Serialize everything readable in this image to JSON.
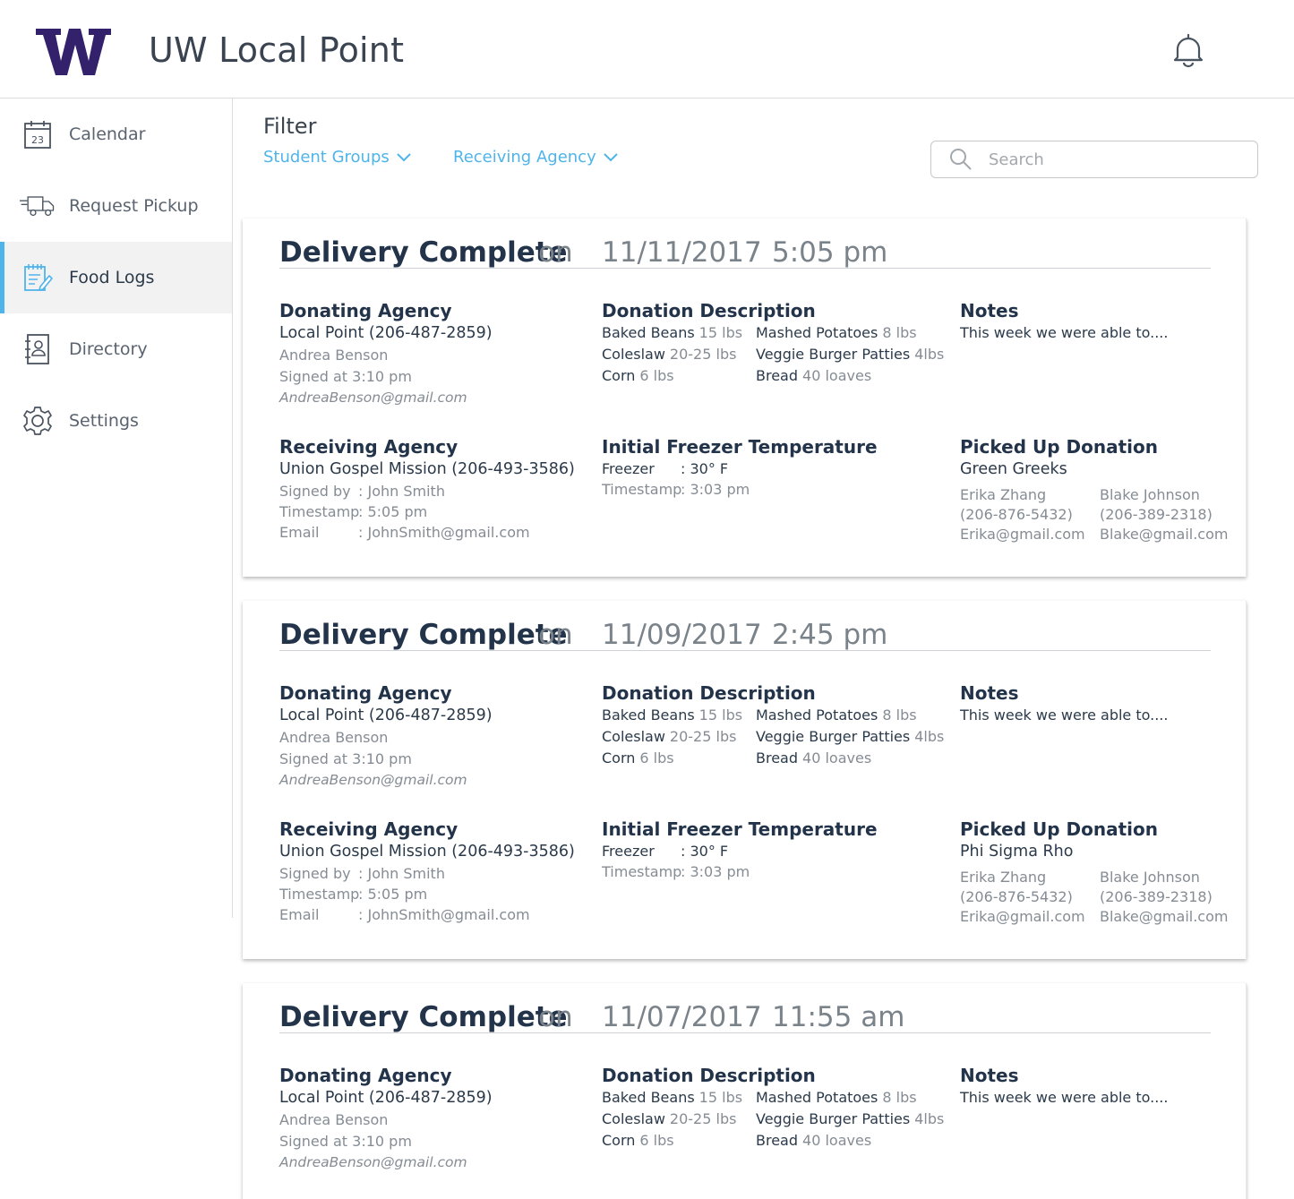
{
  "app": {
    "title": "UW Local Point",
    "logo_letter": "W"
  },
  "colors": {
    "accent": "#4fb4ea",
    "brand": "#33216b",
    "heading": "#23344a"
  },
  "sidebar": {
    "items": [
      {
        "label": "Calendar",
        "icon": "calendar-icon",
        "badge": "23"
      },
      {
        "label": "Request Pickup",
        "icon": "truck-icon"
      },
      {
        "label": "Food Logs",
        "icon": "notepad-icon",
        "active": true
      },
      {
        "label": "Directory",
        "icon": "contact-book-icon"
      },
      {
        "label": "Settings",
        "icon": "gear-icon"
      }
    ]
  },
  "filter": {
    "title": "Filter",
    "student_groups": "Student Groups",
    "receiving_agency": "Receiving Agency",
    "search_placeholder": "Search"
  },
  "labels": {
    "on": "on",
    "donating_agency": "Donating Agency",
    "donation_description": "Donation Description",
    "notes": "Notes",
    "receiving_agency": "Receiving Agency",
    "initial_freezer_temperature": "Initial Freezer Temperature",
    "picked_up_donation": "Picked Up Donation",
    "signed_by": "Signed by",
    "timestamp": "Timestamp",
    "email": "Email",
    "freezer": "Freezer"
  },
  "logs": [
    {
      "status": "Delivery Complete",
      "date": "11/11/2017",
      "time": "5:05 pm",
      "donating": {
        "agency": "Local Point (206-487-2859)",
        "person": "Andrea Benson",
        "signed": "Signed at 3:10 pm",
        "email": "AndreaBenson@gmail.com"
      },
      "items": [
        {
          "name": "Baked Beans",
          "qty": "15 lbs"
        },
        {
          "name": "Mashed Potatoes",
          "qty": "8 lbs"
        },
        {
          "name": "Coleslaw",
          "qty": "20-25 lbs"
        },
        {
          "name": "Veggie Burger Patties",
          "qty": "4lbs"
        },
        {
          "name": "Corn",
          "qty": "6 lbs"
        },
        {
          "name": "Bread",
          "qty": "40 loaves"
        }
      ],
      "notes": "This week we were able to....",
      "receiving": {
        "agency": "Union Gospel Mission (206-493-3586)",
        "signed_by": ": John Smith",
        "timestamp": ": 5:05 pm",
        "email": ": JohnSmith@gmail.com"
      },
      "freezer": {
        "temp": ": 30° F",
        "timestamp": ": 3:03 pm"
      },
      "picked_up": {
        "group": "Green Greeks",
        "contacts": [
          {
            "name": "Erika Zhang",
            "phone": "(206-876-5432)",
            "email": "Erika@gmail.com"
          },
          {
            "name": "Blake Johnson",
            "phone": "(206-389-2318)",
            "email": "Blake@gmail.com"
          }
        ]
      }
    },
    {
      "status": "Delivery Complete",
      "date": "11/09/2017",
      "time": "2:45 pm",
      "donating": {
        "agency": "Local Point (206-487-2859)",
        "person": "Andrea Benson",
        "signed": "Signed at 3:10 pm",
        "email": "AndreaBenson@gmail.com"
      },
      "items": [
        {
          "name": "Baked Beans",
          "qty": "15 lbs"
        },
        {
          "name": "Mashed Potatoes",
          "qty": "8 lbs"
        },
        {
          "name": "Coleslaw",
          "qty": "20-25 lbs"
        },
        {
          "name": "Veggie Burger Patties",
          "qty": "4lbs"
        },
        {
          "name": "Corn",
          "qty": "6 lbs"
        },
        {
          "name": "Bread",
          "qty": "40 loaves"
        }
      ],
      "notes": "This week we were able to....",
      "receiving": {
        "agency": "Union Gospel Mission (206-493-3586)",
        "signed_by": ": John Smith",
        "timestamp": ": 5:05 pm",
        "email": ": JohnSmith@gmail.com"
      },
      "freezer": {
        "temp": ": 30° F",
        "timestamp": ": 3:03 pm"
      },
      "picked_up": {
        "group": "Phi Sigma Rho",
        "contacts": [
          {
            "name": "Erika Zhang",
            "phone": "(206-876-5432)",
            "email": "Erika@gmail.com"
          },
          {
            "name": "Blake Johnson",
            "phone": "(206-389-2318)",
            "email": "Blake@gmail.com"
          }
        ]
      }
    },
    {
      "status": "Delivery Complete",
      "date": "11/07/2017",
      "time": "11:55 am",
      "donating": {
        "agency": "Local Point (206-487-2859)",
        "person": "Andrea Benson",
        "signed": "Signed at 3:10 pm",
        "email": "AndreaBenson@gmail.com"
      },
      "items": [
        {
          "name": "Baked Beans",
          "qty": "15 lbs"
        },
        {
          "name": "Mashed Potatoes",
          "qty": "8 lbs"
        },
        {
          "name": "Coleslaw",
          "qty": "20-25 lbs"
        },
        {
          "name": "Veggie Burger Patties",
          "qty": "4lbs"
        },
        {
          "name": "Corn",
          "qty": "6 lbs"
        },
        {
          "name": "Bread",
          "qty": "40 loaves"
        }
      ],
      "notes": "This week we were able to...."
    }
  ]
}
